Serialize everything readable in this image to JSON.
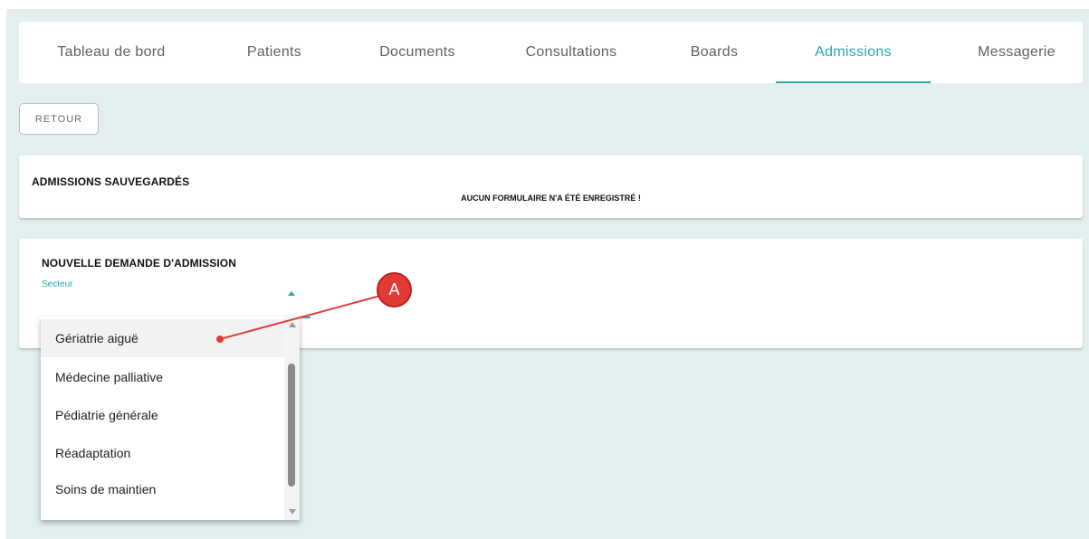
{
  "nav": {
    "tabs": [
      {
        "label": "Tableau de bord"
      },
      {
        "label": "Patients"
      },
      {
        "label": "Documents"
      },
      {
        "label": "Consultations"
      },
      {
        "label": "Boards"
      },
      {
        "label": "Admissions"
      },
      {
        "label": "Messagerie"
      }
    ],
    "active_tab": "Admissions"
  },
  "actions": {
    "retour_label": "RETOUR"
  },
  "saved": {
    "title": "ADMISSIONS SAUVEGARDÉS",
    "empty_message": "AUCUN FORMULAIRE N'A ÉTÉ ENREGISTRÉ !"
  },
  "new_request": {
    "title": "NOUVELLE DEMANDE D'ADMISSION",
    "secteur_label": "Secteur",
    "options": [
      {
        "label": "Gériatrie aiguë"
      },
      {
        "label": "Médecine palliative"
      },
      {
        "label": "Pédiatrie générale"
      },
      {
        "label": "Réadaptation"
      },
      {
        "label": "Soins de maintien"
      }
    ],
    "highlighted_option": "Gériatrie aiguë"
  },
  "annotation": {
    "marker_label": "A"
  },
  "colors": {
    "accent": "#2aa8b0",
    "background": "#e3efef",
    "marker": "#e23a35"
  }
}
